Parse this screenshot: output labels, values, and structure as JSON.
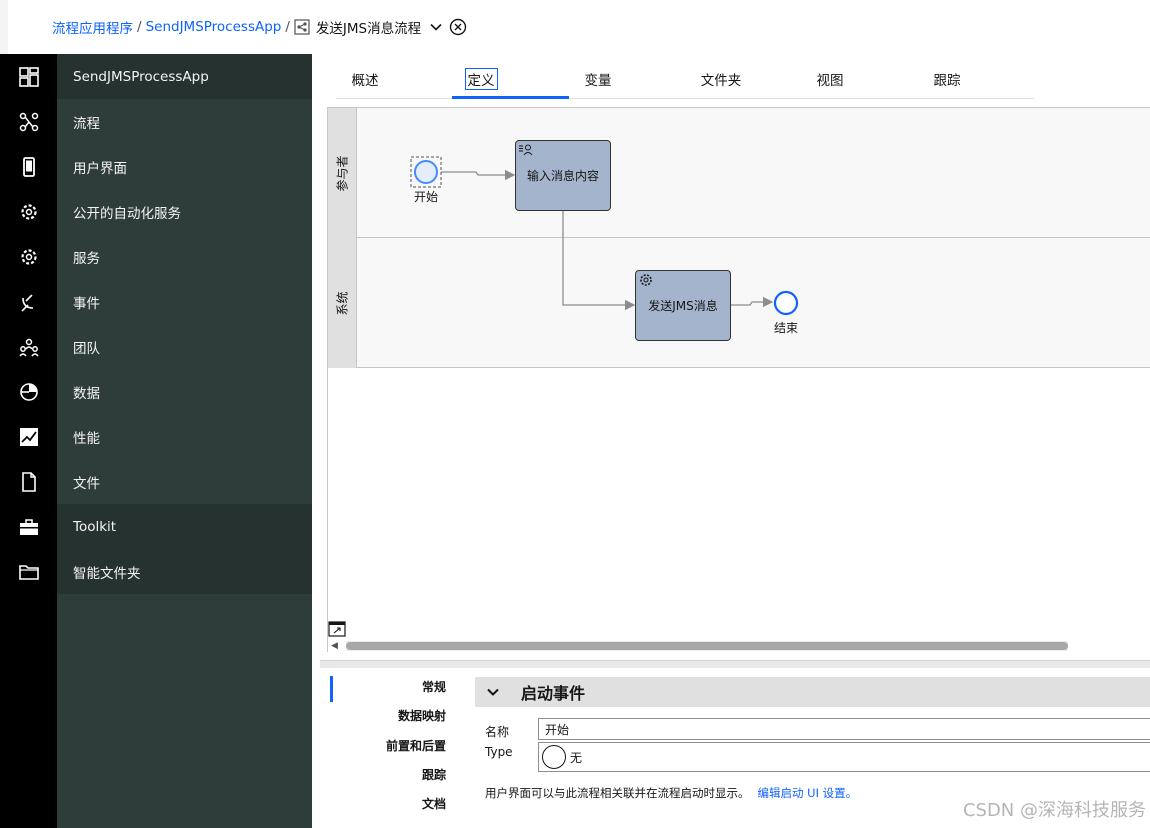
{
  "breadcrumb": {
    "root": "流程应用程序",
    "app": "SendJMSProcessApp",
    "current": "发送JMS消息流程"
  },
  "nav": {
    "items": [
      {
        "label": "SendJMSProcessApp"
      },
      {
        "label": "流程"
      },
      {
        "label": "用户界面"
      },
      {
        "label": "公开的自动化服务"
      },
      {
        "label": "服务"
      },
      {
        "label": "事件"
      },
      {
        "label": "团队"
      },
      {
        "label": "数据"
      },
      {
        "label": "性能"
      },
      {
        "label": "文件"
      },
      {
        "label": "Toolkit"
      },
      {
        "label": "智能文件夹"
      }
    ]
  },
  "tabs": [
    {
      "label": "概述"
    },
    {
      "label": "定义"
    },
    {
      "label": "变量"
    },
    {
      "label": "文件夹"
    },
    {
      "label": "视图"
    },
    {
      "label": "跟踪"
    }
  ],
  "diagram": {
    "lanes": [
      {
        "label": "参与者"
      },
      {
        "label": "系统"
      }
    ],
    "start_label": "开始",
    "task1_label": "输入消息内容",
    "task2_label": "发送JMS消息",
    "end_label": "结束"
  },
  "props": {
    "side": [
      {
        "label": "常规"
      },
      {
        "label": "数据映射"
      },
      {
        "label": "前置和后置"
      },
      {
        "label": "跟踪"
      },
      {
        "label": "文档"
      }
    ],
    "section_title": "启动事件",
    "name_label": "名称",
    "name_value": "开始",
    "type_label": "Type",
    "type_value": "无",
    "hint": "用户界面可以与此流程相关联并在流程启动时显示。",
    "hint_link": "编辑启动 UI 设置。"
  },
  "watermark": "CSDN @深海科技服务",
  "colors": {
    "accent": "#0f62fe",
    "nav_bg": "#2f3d3a",
    "rail_bg": "#000000",
    "task_fill": "#a3b4cc"
  }
}
